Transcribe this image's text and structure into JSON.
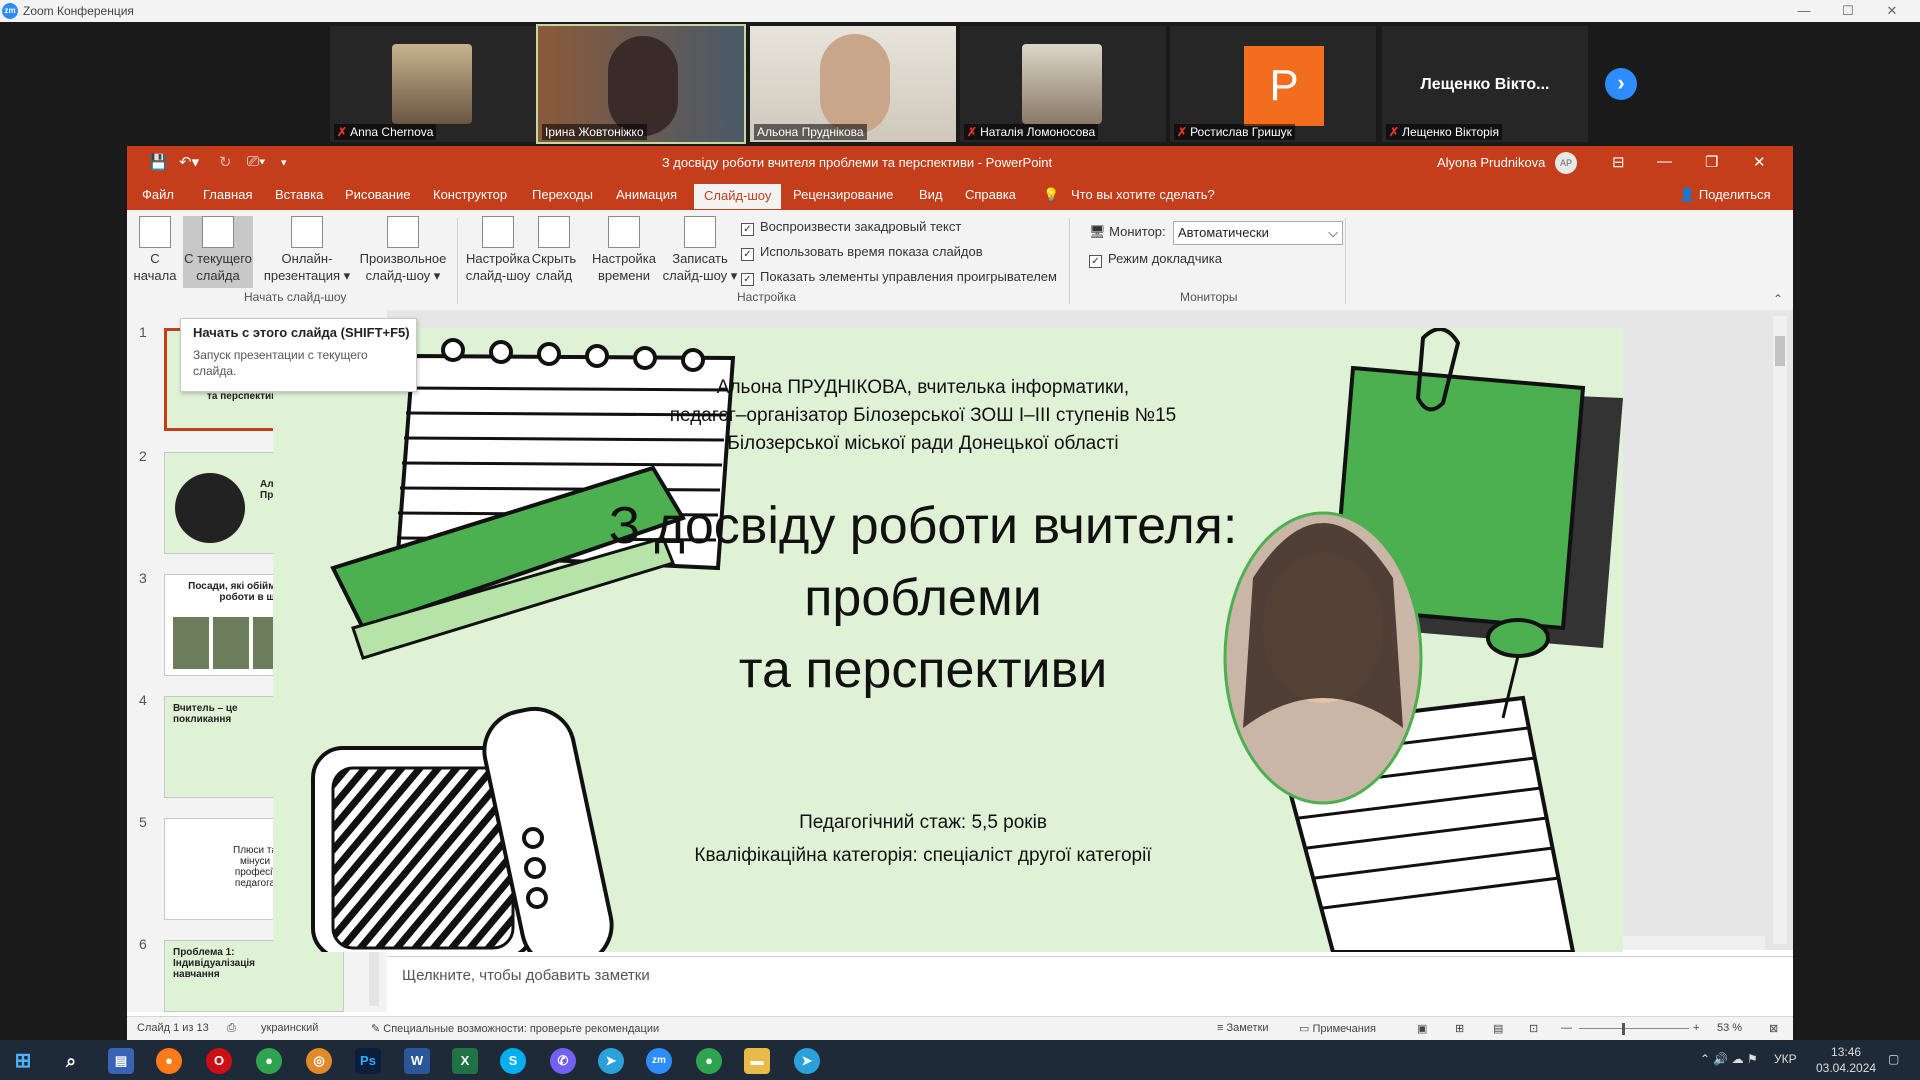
{
  "zoom": {
    "title": "Zoom Конференция"
  },
  "participants": [
    {
      "name": "Anna Chernova",
      "muted": true
    },
    {
      "name": "Ірина Жовтоніжко",
      "muted": false
    },
    {
      "name": "Альона Пруднікова",
      "muted": false
    },
    {
      "name": "Наталія Ломоносова",
      "muted": true
    },
    {
      "name": "Ростислав Гришук",
      "muted": true,
      "avatar_letter": "Р"
    },
    {
      "name": "Лещенко Вікторія",
      "muted": true,
      "display": "Лещенко Вікто..."
    }
  ],
  "ppt": {
    "doc_title": "З досвіду роботи вчителя проблеми та перспективи  -  PowerPoint",
    "user": "Alyona Prudnikova",
    "user_initials": "AP",
    "tabs": [
      "Файл",
      "Главная",
      "Вставка",
      "Рисование",
      "Конструктор",
      "Переходы",
      "Анимация",
      "Слайд-шоу",
      "Рецензирование",
      "Вид",
      "Справка"
    ],
    "tell_me": "Что вы хотите сделать?",
    "share": "Поделиться",
    "ribbon": {
      "from_start": [
        "С",
        "начала"
      ],
      "from_current": [
        "С текущего",
        "слайда"
      ],
      "online": [
        "Онлайн-",
        "презентация ▾"
      ],
      "custom": [
        "Произвольное",
        "слайд-шоу ▾"
      ],
      "group_start": "Начать слайд-шоу",
      "setup": [
        "Настройка",
        "слайд-шоу"
      ],
      "hide": [
        "Скрыть",
        "слайд"
      ],
      "rehearse": [
        "Настройка",
        "времени"
      ],
      "record": [
        "Записать",
        "слайд-шоу ▾"
      ],
      "checks": [
        "Воспроизвести закадровый текст",
        "Использовать время показа слайдов",
        "Показать элементы управления проигрывателем"
      ],
      "group_setup": "Настройка",
      "monitor_label": "Монитор:",
      "monitor_value": "Автоматически",
      "presenter": "Режим докладчика",
      "group_monitors": "Мониторы"
    },
    "tooltip": {
      "title": "Начать с этого слайда (SHIFT+F5)",
      "desc": "Запуск презентации с текущего слайда."
    },
    "thumbs": [
      {
        "n": "1",
        "text": "та перспективи"
      },
      {
        "n": "2",
        "text": "Альона Пруднікова"
      },
      {
        "n": "3",
        "text": "Посади, які обіймала за час роботи в школі"
      },
      {
        "n": "4",
        "text": "Вчитель – це покликання"
      },
      {
        "n": "5",
        "text": "Плюси та мінуси професії педагога"
      },
      {
        "n": "6",
        "text": "Проблема 1: Індивідуалізація навчання"
      }
    ],
    "slide": {
      "header": [
        "Альона ПРУДНІКОВА, вчителька інформатики,",
        "педагог–організатор Білозерської ЗОШ І–ІІІ ступенів №15",
        "Білозерської міської ради Донецької області"
      ],
      "title": [
        "З досвіду роботи вчителя:",
        "проблеми",
        "та перспективи"
      ],
      "footer": [
        "Педагогічний стаж: 5,5 років",
        "Кваліфікаційна категорія: спеціаліст другої категорії"
      ]
    },
    "notes_placeholder": "Щелкните, чтобы добавить заметки",
    "status": {
      "slide": "Слайд 1 из 13",
      "lang": "украинский",
      "access": "Специальные возможности: проверьте рекомендации",
      "notes": "Заметки",
      "comments": "Примечания",
      "zoom": "53 %"
    }
  },
  "taskbar": {
    "lang": "УКР",
    "time": "13:46",
    "date": "03.04.2024"
  }
}
